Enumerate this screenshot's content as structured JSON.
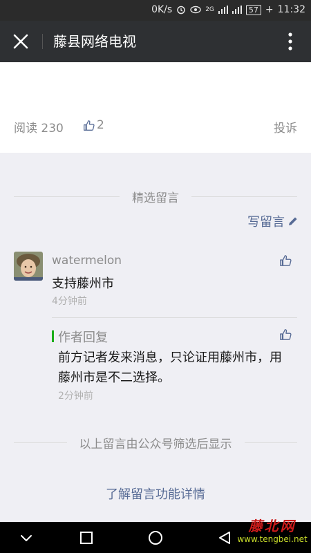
{
  "status_bar": {
    "speed": "0K/s",
    "network": "2G",
    "battery": "57",
    "time": "11:32"
  },
  "app_bar": {
    "title": "藤县网络电视"
  },
  "article_footer": {
    "read_label": "阅读 230",
    "like_count": "2",
    "report_label": "投诉"
  },
  "comments": {
    "section_title": "精选留言",
    "write_label": "写留言",
    "items": [
      {
        "nickname": "watermelon",
        "text": "支持藤州市",
        "time": "4分钟前",
        "reply": {
          "label": "作者回复",
          "text": "前方记者发来消息，只论证用藤州市，用藤州市是不二选择。",
          "time": "2分钟前"
        }
      }
    ],
    "filter_note": "以上留言由公众号筛选后显示",
    "learn_more": "了解留言功能详情"
  },
  "watermark": {
    "name": "藤北网",
    "url": "www.tengbei.net"
  },
  "icons": {
    "close": "close-icon",
    "more": "more-vertical-icon",
    "like": "thumbs-up-icon",
    "edit": "pencil-icon",
    "back": "nav-back-icon",
    "home": "nav-home-icon",
    "recents": "nav-recents-icon",
    "collapse": "chevron-down-icon"
  },
  "colors": {
    "link": "#576b95",
    "reply_accent": "#1aad19",
    "appbar": "#2e3033",
    "background": "#efeff4"
  }
}
